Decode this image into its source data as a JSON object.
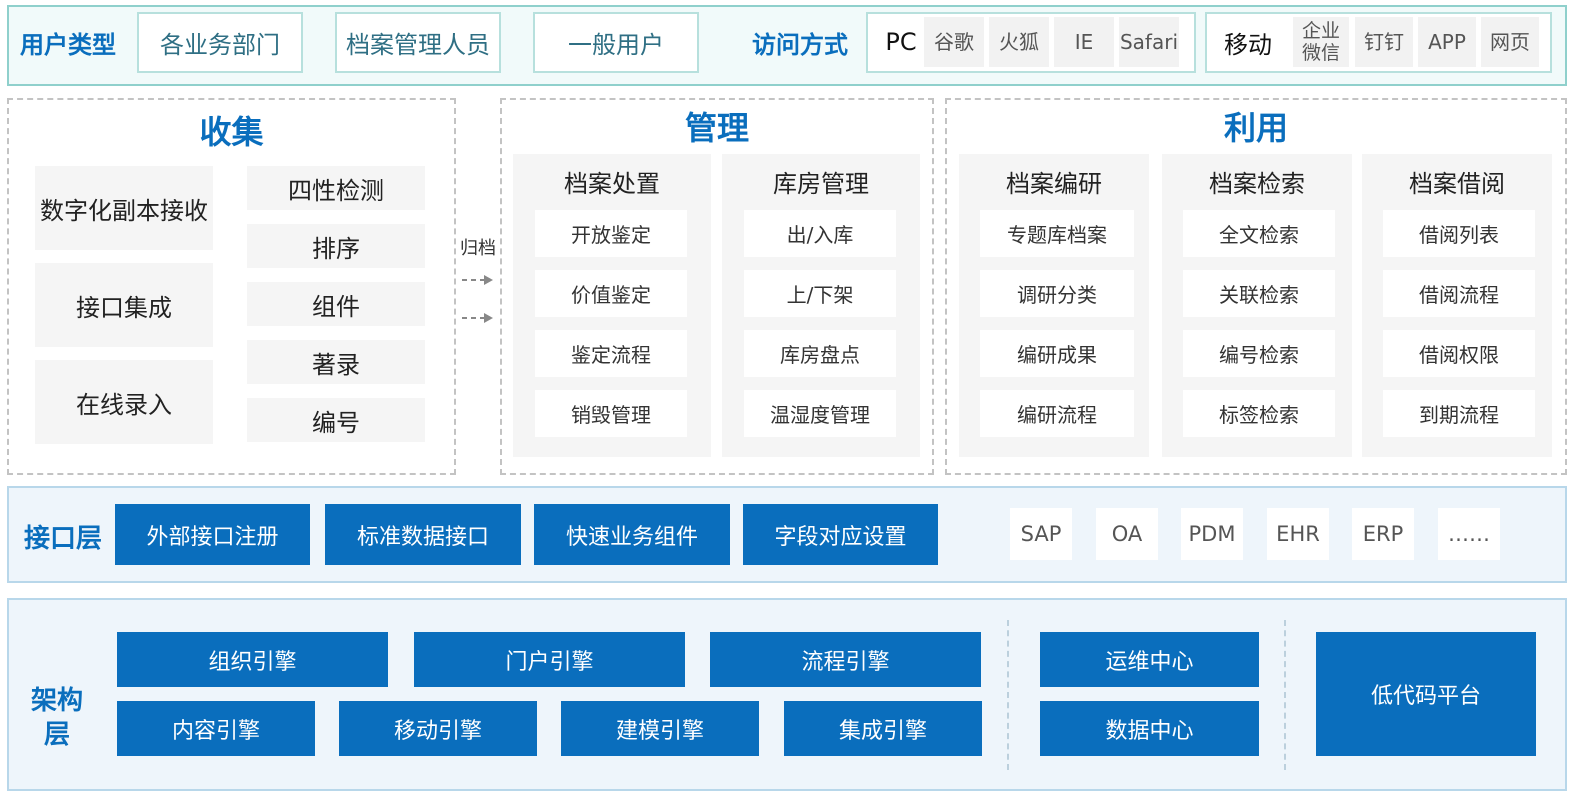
{
  "user_row": {
    "label": "用户类型",
    "types": [
      "各业务部门",
      "档案管理人员",
      "一般用户"
    ],
    "access_label": "访问方式",
    "pc": {
      "label": "PC",
      "options": [
        "谷歌",
        "火狐",
        "IE",
        "Safari"
      ]
    },
    "mobile": {
      "label": "移动",
      "options": [
        "企业微信",
        "钉钉",
        "APP",
        "网页"
      ]
    }
  },
  "collect": {
    "title": "收集",
    "left_blocks": [
      "数字化副本接收",
      "接口集成",
      "在线录入"
    ],
    "right_blocks": [
      "四性检测",
      "排序",
      "组件",
      "著录",
      "编号"
    ]
  },
  "archive_label": "归档",
  "manage": {
    "title": "管理",
    "panels": [
      {
        "title": "档案处置",
        "items": [
          "开放鉴定",
          "价值鉴定",
          "鉴定流程",
          "销毁管理"
        ]
      },
      {
        "title": "库房管理",
        "items": [
          "出/入库",
          "上/下架",
          "库房盘点",
          "温湿度管理"
        ]
      }
    ]
  },
  "use": {
    "title": "利用",
    "panels": [
      {
        "title": "档案编研",
        "items": [
          "专题库档案",
          "调研分类",
          "编研成果",
          "编研流程"
        ]
      },
      {
        "title": "档案检索",
        "items": [
          "全文检索",
          "关联检索",
          "编号检索",
          "标签检索"
        ]
      },
      {
        "title": "档案借阅",
        "items": [
          "借阅列表",
          "借阅流程",
          "借阅权限",
          "到期流程"
        ]
      }
    ]
  },
  "interface": {
    "label": "接口层",
    "boxes": [
      "外部接口注册",
      "标准数据接口",
      "快速业务组件",
      "字段对应设置"
    ],
    "systems": [
      "SAP",
      "OA",
      "PDM",
      "EHR",
      "ERP",
      "……"
    ]
  },
  "arch": {
    "label": "架构层",
    "engines_top": [
      "组织引擎",
      "门户引擎",
      "流程引擎"
    ],
    "engines_bottom": [
      "内容引擎",
      "移动引擎",
      "建模引擎",
      "集成引擎"
    ],
    "centers": [
      "运维中心",
      "数据中心"
    ],
    "platform": "低代码平台"
  },
  "colors": {
    "brand_blue": "#0a6ebd",
    "teal_border": "#8fd0cc",
    "light_blue_bg": "#eef5fb"
  }
}
